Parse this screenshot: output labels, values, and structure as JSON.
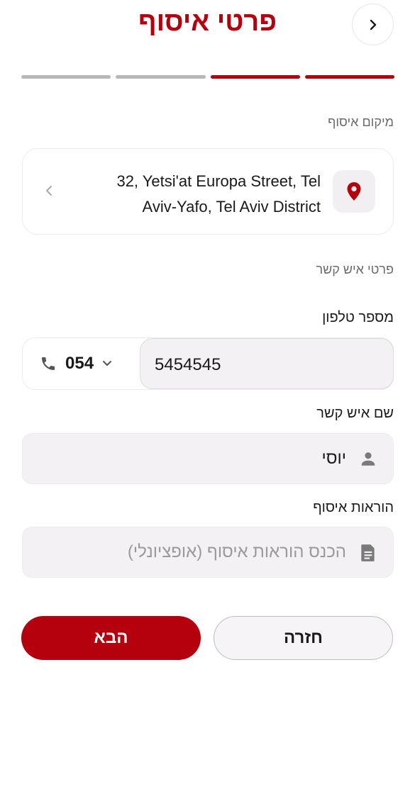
{
  "header": {
    "title": "פרטי איסוף",
    "back_icon": "chevron-right-icon"
  },
  "progress": {
    "steps_total": 4,
    "steps_completed": 2
  },
  "location": {
    "section_label": "מיקום איסוף",
    "address": "32, Yetsi'at Europa Street, Tel Aviv-Yafo, Tel Aviv District",
    "icon": "location-pin-icon"
  },
  "contact": {
    "section_label": "פרטי איש קשר",
    "phone_label": "מספר טלפון",
    "phone_prefix": "054",
    "phone_number": "5454545",
    "name_label": "שם איש קשר",
    "name_value": "יוסי",
    "instructions_label": "הוראות איסוף",
    "instructions_placeholder": "הכנס הוראות איסוף (אופציונלי)"
  },
  "actions": {
    "next_label": "הבא",
    "back_label": "חזרה"
  },
  "colors": {
    "accent": "#b5000e",
    "inactive_step": "#b8b8b8",
    "field_bg": "#f3f1f4"
  }
}
